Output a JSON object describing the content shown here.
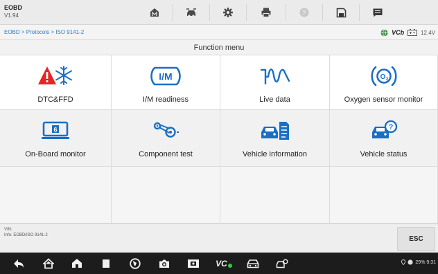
{
  "app": {
    "name": "EOBD",
    "version": "V1.94"
  },
  "breadcrumb": "EOBD > Protocols > ISO 9141-2",
  "status": {
    "vci_label": "VCb",
    "voltage": "12.4V"
  },
  "section_title": "Function menu",
  "functions": [
    {
      "label": "DTC&FFD",
      "icon": "warning-snowflake-icon"
    },
    {
      "label": "I/M readiness",
      "icon": "im-icon"
    },
    {
      "label": "Live data",
      "icon": "waveform-icon"
    },
    {
      "label": "Oxygen sensor monitor",
      "icon": "oxygen-sensor-icon"
    },
    {
      "label": "On-Board monitor",
      "icon": "monitor-icon"
    },
    {
      "label": "Component test",
      "icon": "component-test-icon"
    },
    {
      "label": "Vehicle information",
      "icon": "vehicle-info-icon"
    },
    {
      "label": "Vehicle status",
      "icon": "vehicle-status-icon"
    }
  ],
  "info": {
    "vin": "VIN:",
    "info": "Info: EOBD/ISO 9141-2"
  },
  "esc_label": "ESC",
  "navbar": {
    "vci_label": "VC",
    "system_status": "29% 9:31"
  },
  "colors": {
    "accent": "#1a6fc4",
    "warning": "#e82323",
    "link": "#2a7fc9"
  }
}
